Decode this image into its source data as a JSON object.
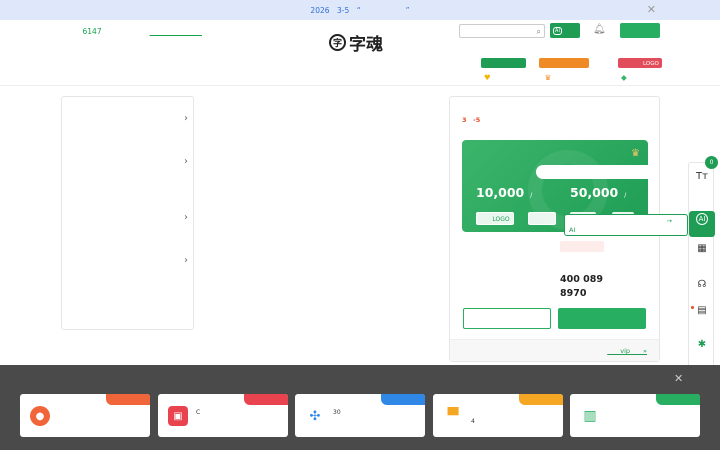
{
  "banner": {
    "text": "　　2026　3-5　“　　　　　　”　　",
    "close": "✕"
  },
  "header": {
    "welcome_prefix": "　　　",
    "welcome_count": "6147",
    "welcome_suffix": "　　　　　",
    "welcome_link": "　　　　　　　",
    "logo_mark": "字",
    "logo_text": "字魂",
    "search_placeholder": "　　　",
    "ai_label": "　　",
    "ai_badge": "AI",
    "login_label": "　　　　"
  },
  "nav": {
    "items": [
      "　　　　",
      "　　　　",
      "　　　　",
      "　　　　",
      "　　　　",
      "　　　",
      "　　　　　　"
    ],
    "promos": [
      {
        "tag": "　　　　　　　",
        "label": "　　　　",
        "icon": "♥",
        "tag_color": "#1f9d55",
        "icon_color": "#f5b400"
      },
      {
        "tag": "　　　　　　　　",
        "label": "　　　　",
        "icon": "♛",
        "tag_color": "#f08a24",
        "icon_color": "#f08a24"
      },
      {
        "tag": "　　　　LOGO",
        "label": "　　　　",
        "icon": "◆",
        "tag_color": "#e14d5a",
        "icon_color": "#3bb56a"
      }
    ]
  },
  "skeleton": "· · · · · · · · ·",
  "sidebar": {
    "groups": [
      {
        "title": "　　　　",
        "items": "　　　　　　　　　　　　　　　　"
      },
      {
        "title": "　　　　",
        "items": "　　　　　　　　　　　　　　　　　　　　　　　　　　"
      },
      {
        "title": "　　　　",
        "items": "　　　　　　　　　　　　"
      },
      {
        "title": "　　　　",
        "items": "　　　　　　　　　　　　　　　　　　　　　　　　　　　"
      }
    ],
    "arrow": "›"
  },
  "categories": [
    {
      "a": "　　　　",
      "b": "　　"
    },
    {
      "a": "　　　　",
      "b": "　　"
    },
    {
      "a": "　　　　",
      "b": "　　　　"
    },
    {
      "a": "　　　　",
      "b": "　　"
    }
  ],
  "right_panel": {
    "notice_pre": "　　　　　　　　　　　　　　　　　　　　　　　　　　　",
    "notice_highlight": "3　-5",
    "notice_post": "　　　　　　　　　　　　　　　　　　　　　　",
    "card_title": "　　　　　　",
    "card_sub": "　　　　",
    "card_pill": "　　　　　　　　　　　",
    "price1": "10,000",
    "price1_unit": "　/　",
    "price2": "50,000",
    "price2_unit": "　/　",
    "btn1": "　　LOGO",
    "btn2": "　　　　",
    "tooltip": "　　　　　　　　　　　　　　　→　　AI　　　　　　　　",
    "service_badge": "　　　　　　",
    "hotline_label": "　　　　　　　　",
    "hotline_number": "400 089 8970",
    "btn_outline": "　　　　　　",
    "btn_solid": "　　　　　　",
    "footer_text": "　　　　　　　　　　　　　　　　　",
    "footer_vip": "　　vip　　»"
  },
  "hot_title": "　　　　",
  "float_bar": {
    "count": "0",
    "items": [
      {
        "icon": "Tт",
        "label": "　　　　"
      },
      {
        "icon": "AI",
        "label": "　　"
      },
      {
        "icon": "▦",
        "label": "　　　　"
      },
      {
        "icon": "☊",
        "label": "　　"
      },
      {
        "icon": "▤",
        "label": "　　　　"
      },
      {
        "icon": "✱",
        "label": "　　　　"
      }
    ]
  },
  "overlay": {
    "title": "　　　　　　　　　　　　　　　　　　　",
    "close": "✕",
    "cards": [
      {
        "ribbon": "　　　　",
        "ribbon_color": "#f0663a",
        "icon_color": "#f0663a",
        "icon": "●",
        "text": "　　　　　　　　　　　　　　　　　　　　　"
      },
      {
        "ribbon": "　　　　",
        "ribbon_color": "#e8434f",
        "icon_color": "#e8434f",
        "icon": "▣",
        "text": "C　　　　　　　　　　　　　　　　　　　　　　　　　"
      },
      {
        "ribbon": "　　　　",
        "ribbon_color": "#2f88e6",
        "icon_color": "#2f88e6",
        "icon": "✣",
        "text": "30　　　　　　　　　　　　　　　　　　　　　　　　　"
      },
      {
        "ribbon": "　　　　",
        "ribbon_color": "#f5a623",
        "icon_color": "#f5a623",
        "icon": "▀",
        "text": "　　　　　　　　　　　　　　　　　4　　　"
      },
      {
        "ribbon": "　　　　",
        "ribbon_color": "#27ae60",
        "icon_color": "#27ae60",
        "icon": "▥",
        "text": "　　　　　　　　　　　　　　　　　　　　　　"
      }
    ]
  }
}
